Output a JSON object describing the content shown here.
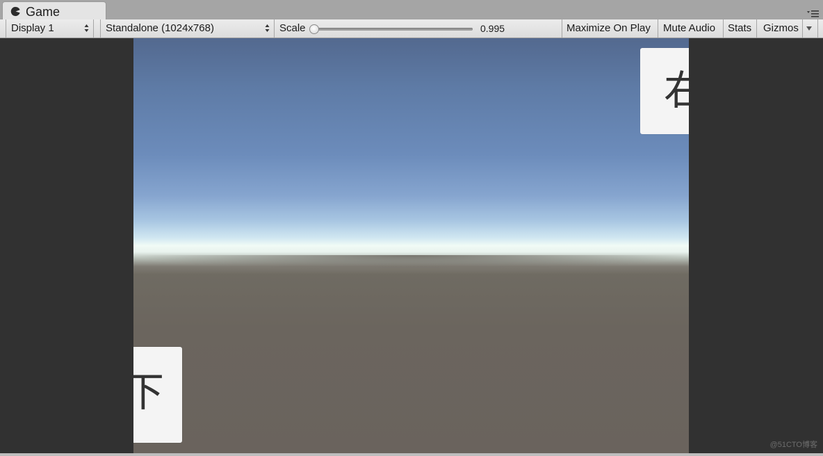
{
  "window": {
    "tab_title": "Game",
    "tab_icon": "pacman-game-icon"
  },
  "toolbar": {
    "display_select": {
      "value": "Display 1"
    },
    "resolution_select": {
      "value": "Standalone (1024x768)"
    },
    "scale": {
      "label": "Scale",
      "value_text": "0.995",
      "value": 0.995
    },
    "maximize_on_play": "Maximize On Play",
    "mute_audio": "Mute Audio",
    "stats": "Stats",
    "gizmos": "Gizmos"
  },
  "game": {
    "right_button_text": "右",
    "down_button_text": "下",
    "sky_color_top": "#53698f",
    "horizon_color": "#f1fbf6",
    "ground_color": "#6a635d",
    "letterbox_color": "#313131"
  },
  "watermark": "@51CTO博客"
}
